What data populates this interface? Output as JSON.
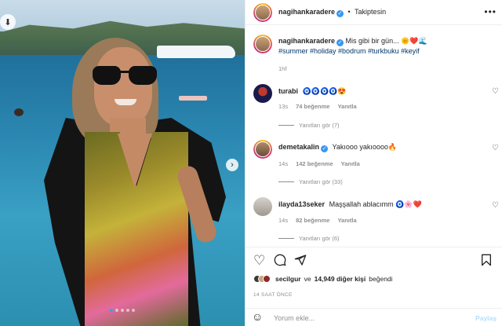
{
  "post": {
    "carousel": {
      "slides": 5,
      "active_index": 0
    }
  },
  "header": {
    "username": "nagihankaradere",
    "separator": "•",
    "follow_status": "Takiptesin",
    "more": "•••"
  },
  "caption": {
    "username": "nagihankaradere",
    "text": "Mis gibi bir gün... 🌞❤️🌊",
    "hashtags": "#summer #holiday #bodrum #turkbuku #keyif",
    "time": "1hf"
  },
  "comments": [
    {
      "username": "turabi",
      "text": "🧿🧿🧿🧿😍",
      "time": "13s",
      "likes": "74 beğenme",
      "reply": "Yanıtla",
      "see_replies": "Yanıtları gör (7)"
    },
    {
      "username": "demetakalin",
      "text": "Yakıooo yakıoooo🔥",
      "time": "14s",
      "likes": "142 beğenme",
      "reply": "Yanıtla",
      "see_replies": "Yanıtları gör (33)"
    },
    {
      "username": "ilayda13seker",
      "text": "Maşşallah ablacımm 🧿🌸❤️",
      "time": "14s",
      "likes": "82 beğenme",
      "reply": "Yanıtla",
      "see_replies": "Yanıtları gör (6)"
    }
  ],
  "actions": {
    "like_icon": "heart-outline-icon",
    "comment_icon": "comment-icon",
    "share_icon": "paper-plane-icon",
    "save_icon": "bookmark-icon"
  },
  "likes_line": {
    "user": "secilgur",
    "connector": "ve",
    "count": "14,949 diğer kişi",
    "suffix": "beğendi"
  },
  "timestamp": "14 SAAT ÖNCE",
  "comment_box": {
    "placeholder": "Yorum ekle...",
    "submit": "Paylaş"
  },
  "colors": {
    "verified": "#3897f0",
    "link": "#00376b",
    "muted": "#8e8e8e",
    "share_disabled": "#b2dffc"
  }
}
